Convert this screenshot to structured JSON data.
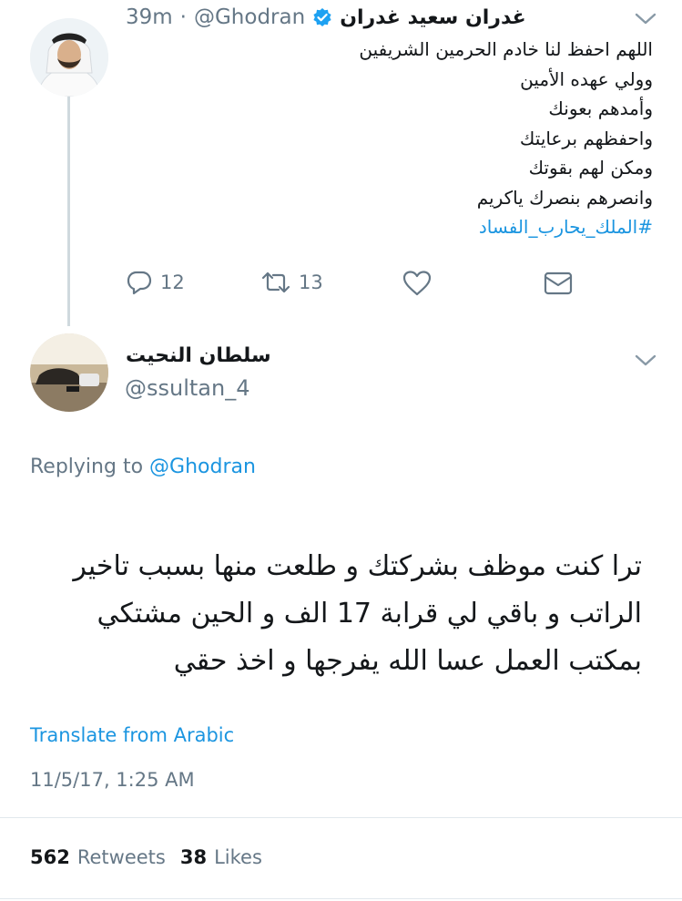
{
  "original_tweet": {
    "author_name": "غدران سعيد غدران",
    "handle": "@Ghodran",
    "separator": "·",
    "time": "39m",
    "lines": [
      "اللهم احفظ لنا خادم الحرمين الشريفين",
      "وولي عهده الأمين",
      "وأمدهم بعونك",
      "واحفظهم برعايتك",
      "ومكن لهم بقوتك",
      "وانصرهم بنصرك ياكريم"
    ],
    "hashtag": "#الملك_يحارب_الفساد",
    "actions": {
      "replies": "12",
      "retweets": "13"
    },
    "icons": {
      "verified": "verified-badge-icon",
      "reply": "reply-icon",
      "retweet": "retweet-icon",
      "like": "heart-icon",
      "dm": "envelope-icon",
      "more": "chevron-down-icon"
    }
  },
  "reply_tweet": {
    "author_name": "سلطان النحيت",
    "handle": "@ssultan_4",
    "replying_prefix": "Replying to",
    "replying_mention": "@Ghodran",
    "body_lines": [
      "ترا كنت موظف بشركتك و طلعت منها بسبب تاخير",
      "الراتب و باقي لي قرابة 17 الف و الحين مشتكي",
      "بمكتب العمل عسا الله يفرجها و اخذ حقي"
    ],
    "translate_label": "Translate from Arabic",
    "timestamp": "11/5/17, 1:25 AM",
    "stats": {
      "retweets_count": "562",
      "retweets_label": "Retweets",
      "likes_count": "38",
      "likes_label": "Likes"
    }
  },
  "colors": {
    "link_blue": "#1b95e0",
    "secondary_gray": "#657786",
    "text_dark": "#14171a",
    "divider": "#e1e8ed",
    "thread_line": "#cfd9de"
  }
}
